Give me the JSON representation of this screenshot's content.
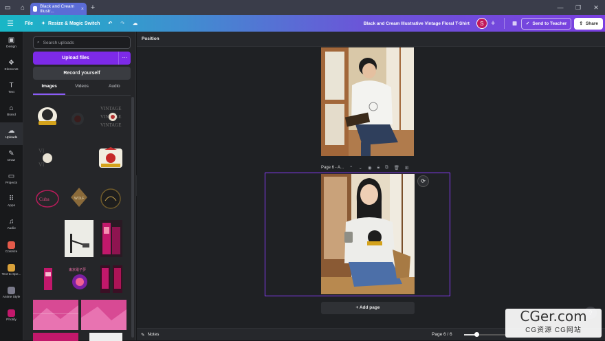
{
  "browser": {
    "tab_title": "Black and Cream Illustr...",
    "tab_close": "×",
    "new_tab": "+",
    "window_controls": [
      "—",
      "❐",
      "✕"
    ]
  },
  "header": {
    "file_label": "File",
    "resize_label": "Resize & Magic Switch",
    "design_title": "Black and Cream Illustrative Vintage Floral T-Shirt",
    "avatar_initial": "S",
    "send_label": "Send to Teacher",
    "share_label": "Share",
    "accent_color": "#7d2ae8"
  },
  "rail": {
    "items": [
      {
        "label": "Design",
        "icon": "design-icon",
        "glyph": "▣"
      },
      {
        "label": "Elements",
        "icon": "elements-icon",
        "glyph": "❖"
      },
      {
        "label": "Text",
        "icon": "text-icon",
        "glyph": "T"
      },
      {
        "label": "Brand",
        "icon": "brand-icon",
        "glyph": "⌂"
      },
      {
        "label": "Uploads",
        "icon": "uploads-icon",
        "glyph": "☁"
      },
      {
        "label": "Draw",
        "icon": "draw-icon",
        "glyph": "✎"
      },
      {
        "label": "Projects",
        "icon": "projects-icon",
        "glyph": "▭"
      },
      {
        "label": "Apps",
        "icon": "apps-icon",
        "glyph": "⠿"
      },
      {
        "label": "Audio",
        "icon": "audio-icon",
        "glyph": "♫"
      },
      {
        "label": "Colorize",
        "icon": "colorize-app-icon",
        "glyph": ""
      },
      {
        "label": "Text to Spe...",
        "icon": "text-to-speech-app-icon",
        "glyph": ""
      },
      {
        "label": "Anime Style",
        "icon": "anime-style-app-icon",
        "glyph": ""
      },
      {
        "label": "Photify",
        "icon": "photify-app-icon",
        "glyph": ""
      }
    ]
  },
  "panel": {
    "search_placeholder": "Search uploads",
    "upload_label": "Upload files",
    "upload_more": "···",
    "record_label": "Record yourself",
    "media_tabs": [
      "Images",
      "Videos",
      "Audio"
    ]
  },
  "editor": {
    "position_label": "Position",
    "page_label": "Page 6 - A...",
    "add_page_label": "+ Add page"
  },
  "footer": {
    "notes_label": "Notes",
    "page_count": "Page 6 / 6",
    "zoom_fraction": 0.3
  },
  "watermark": {
    "line1": "CGer.com",
    "line2": "CG资源 CG网站"
  }
}
